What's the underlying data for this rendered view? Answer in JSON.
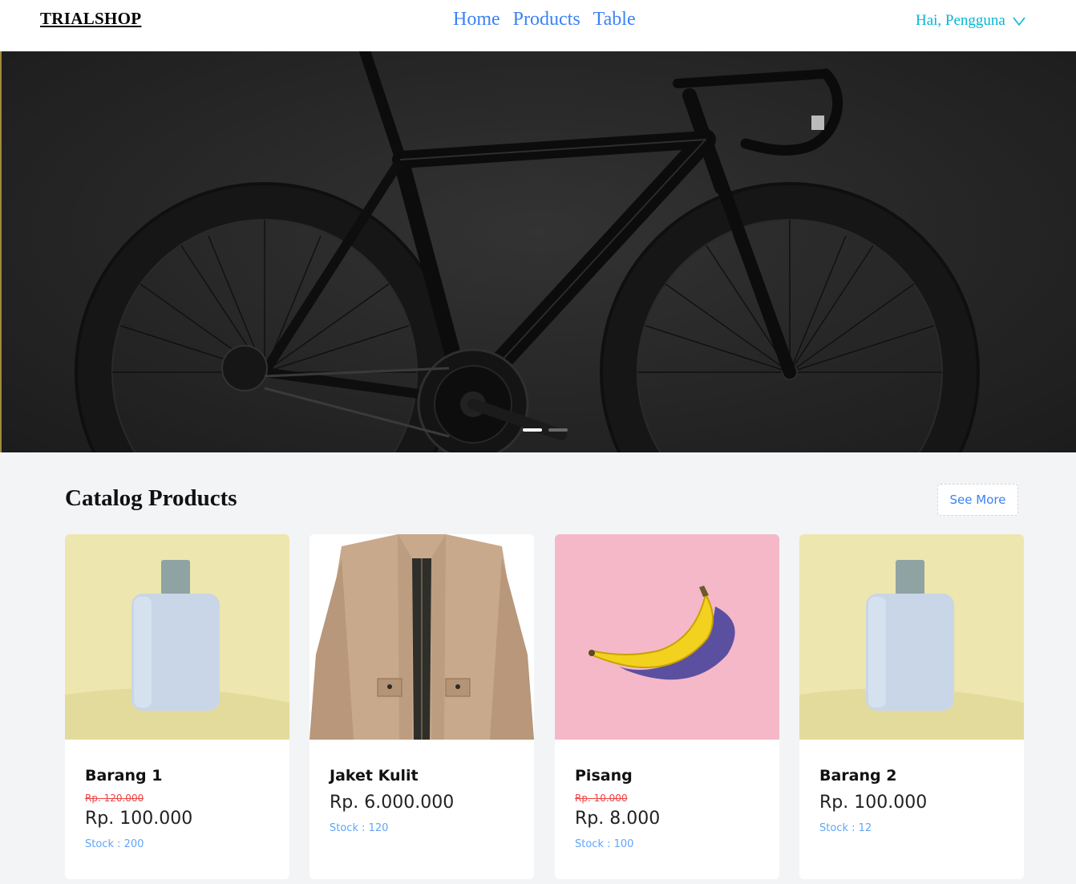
{
  "navbar": {
    "brand": "TRIALSHOP",
    "links": [
      "Home",
      "Products",
      "Table"
    ],
    "user_greeting": "Hai, Pengguna",
    "user_icon": "chevron-down-icon"
  },
  "hero": {
    "image": "black-road-bicycle",
    "slides_total": 2,
    "active_slide": 1
  },
  "catalog": {
    "title": "Catalog Products",
    "see_more_label": "See More",
    "products": [
      {
        "name": "Barang 1",
        "old_price": "Rp. 120.000",
        "price": "Rp. 100.000",
        "stock": "Stock : 200",
        "image": "light-blue-bottle-on-yellow"
      },
      {
        "name": "Jaket Kulit",
        "old_price": "",
        "price": "Rp. 6.000.000",
        "stock": "Stock : 120",
        "image": "beige-jacket"
      },
      {
        "name": "Pisang",
        "old_price": "Rp. 10.000",
        "price": "Rp. 8.000",
        "stock": "Stock : 100",
        "image": "banana-on-pink"
      },
      {
        "name": "Barang 2",
        "old_price": "",
        "price": "Rp. 100.000",
        "stock": "Stock : 12",
        "image": "light-blue-bottle-on-yellow"
      }
    ]
  },
  "colors": {
    "link": "#3b82f6",
    "user": "#06b6d4",
    "discount": "#ef4444",
    "stock": "#60a5fa",
    "page_bg": "#f3f4f6"
  }
}
